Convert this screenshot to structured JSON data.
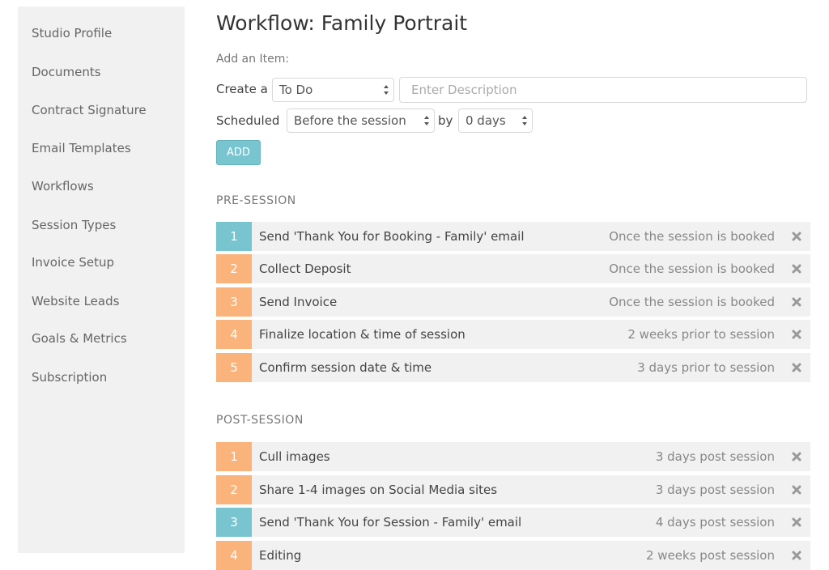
{
  "sidebar": {
    "items": [
      {
        "label": "Studio Profile"
      },
      {
        "label": "Documents"
      },
      {
        "label": "Contract Signature"
      },
      {
        "label": "Email Templates"
      },
      {
        "label": "Workflows"
      },
      {
        "label": "Session Types"
      },
      {
        "label": "Invoice Setup"
      },
      {
        "label": "Website Leads"
      },
      {
        "label": "Goals & Metrics"
      },
      {
        "label": "Subscription"
      }
    ]
  },
  "page": {
    "title": "Workflow: Family Portrait",
    "add_item_label": "Add an Item:"
  },
  "form": {
    "create_label": "Create a",
    "type_value": "To Do",
    "description_placeholder": "Enter Description",
    "scheduled_label": "Scheduled",
    "timing_value": "Before the session",
    "by_label": "by",
    "offset_value": "0 days",
    "add_button": "ADD"
  },
  "colors": {
    "teal": "#78c4cf",
    "orange": "#f9b37b",
    "row_bg": "#f1f1f1",
    "sidebar_bg": "#f1f1f1"
  },
  "pre_session": {
    "title": "PRE-SESSION",
    "tasks": [
      {
        "num": "1",
        "label": "Send 'Thank You for Booking - Family' email",
        "when": "Once the session is booked",
        "color": "teal"
      },
      {
        "num": "2",
        "label": "Collect Deposit",
        "when": "Once the session is booked",
        "color": "orange"
      },
      {
        "num": "3",
        "label": "Send Invoice",
        "when": "Once the session is booked",
        "color": "orange"
      },
      {
        "num": "4",
        "label": "Finalize location & time of session",
        "when": "2 weeks prior to session",
        "color": "orange"
      },
      {
        "num": "5",
        "label": "Confirm session date & time",
        "when": "3 days prior to session",
        "color": "orange"
      }
    ]
  },
  "post_session": {
    "title": "POST-SESSION",
    "tasks": [
      {
        "num": "1",
        "label": "Cull images",
        "when": "3 days post session",
        "color": "orange"
      },
      {
        "num": "2",
        "label": "Share 1-4 images on Social Media sites",
        "when": "3 days post session",
        "color": "orange"
      },
      {
        "num": "3",
        "label": "Send 'Thank You for Session - Family' email",
        "when": "4 days post session",
        "color": "teal"
      },
      {
        "num": "4",
        "label": "Editing",
        "when": "2 weeks post session",
        "color": "orange"
      }
    ]
  }
}
